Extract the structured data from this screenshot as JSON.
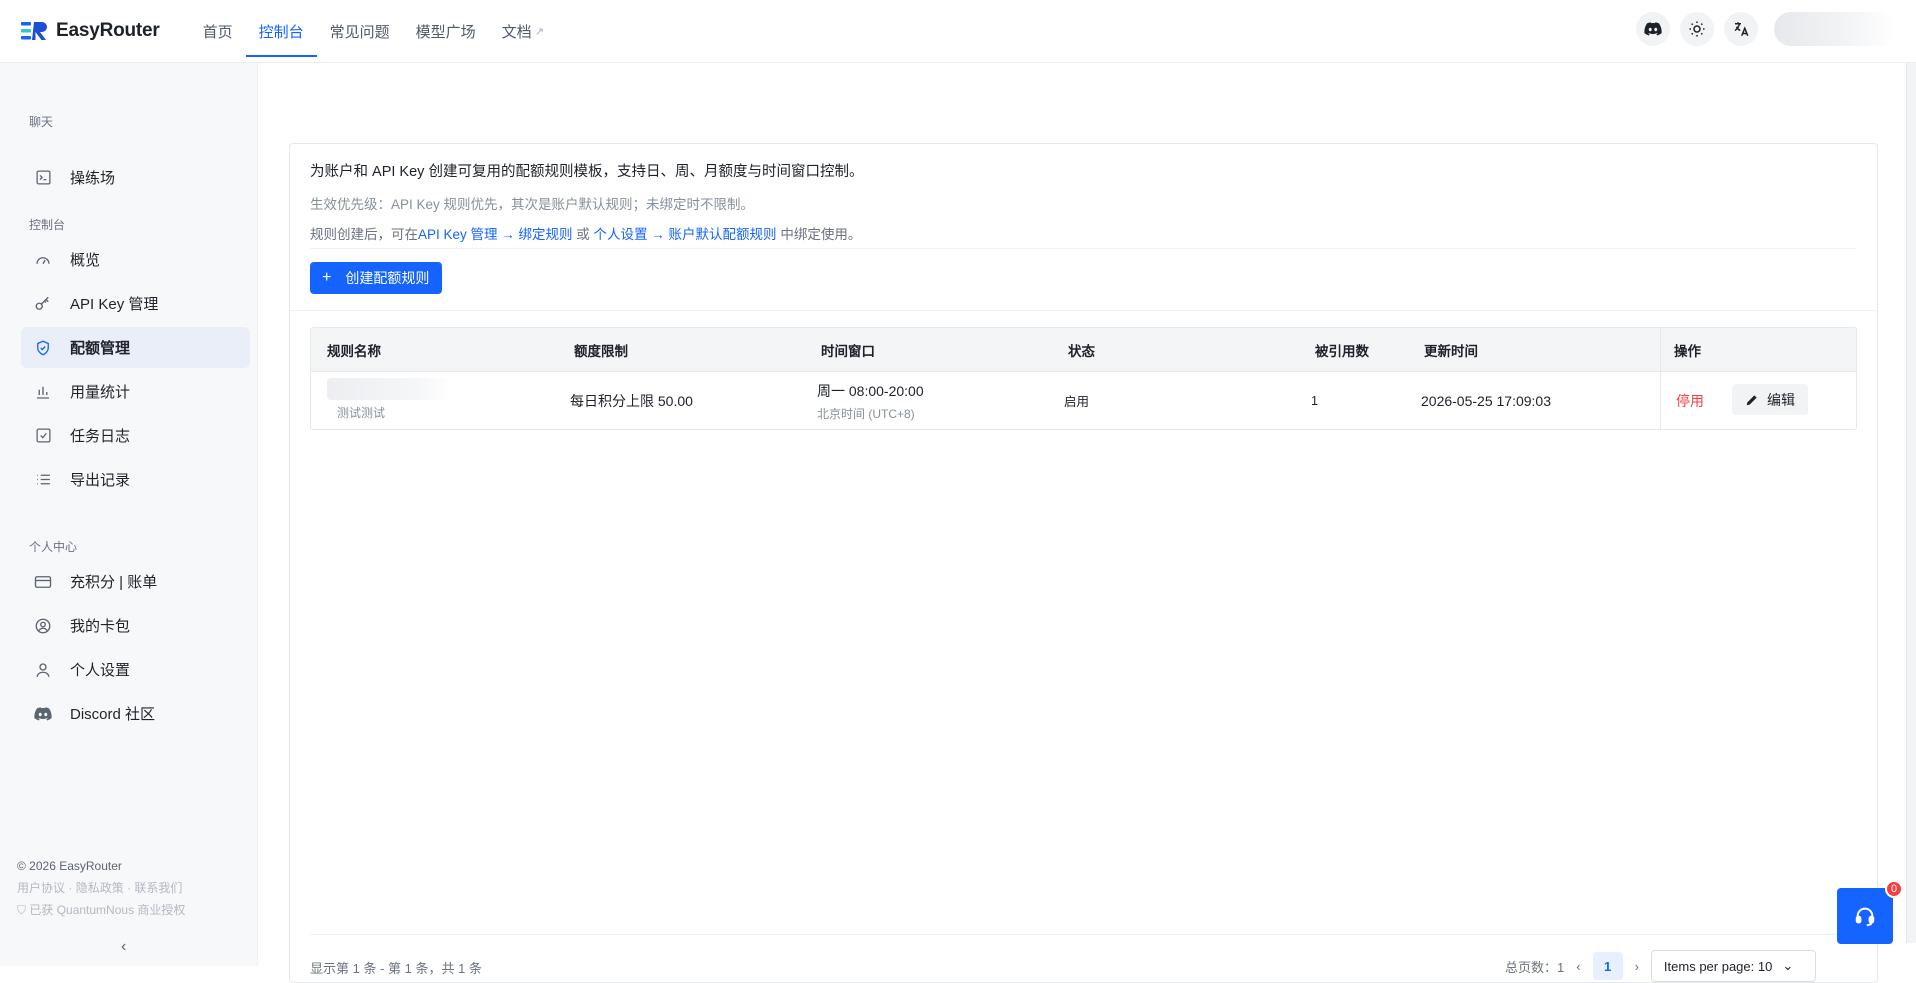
{
  "app": {
    "name": "EasyRouter"
  },
  "nav": {
    "items": [
      "首页",
      "控制台",
      "常见问题",
      "模型广场",
      "文档"
    ],
    "active": "控制台"
  },
  "header_icons": [
    "discord-icon",
    "sun-icon",
    "translate-icon"
  ],
  "sidebar": {
    "groups": [
      {
        "title": "聊天",
        "items": [
          {
            "label": "操练场",
            "icon": "terminal-icon"
          }
        ]
      },
      {
        "title": "控制台",
        "items": [
          {
            "label": "概览",
            "icon": "gauge-icon"
          },
          {
            "label": "API Key 管理",
            "icon": "key-icon"
          },
          {
            "label": "配额管理",
            "icon": "shield-check-icon",
            "active": true
          },
          {
            "label": "用量统计",
            "icon": "bar-chart-icon"
          },
          {
            "label": "任务日志",
            "icon": "checkbox-icon"
          },
          {
            "label": "导出记录",
            "icon": "list-icon"
          }
        ]
      },
      {
        "title": "个人中心",
        "items": [
          {
            "label": "充积分 | 账单",
            "icon": "credit-card-icon"
          },
          {
            "label": "我的卡包",
            "icon": "user-circle-icon"
          },
          {
            "label": "个人设置",
            "icon": "user-icon"
          },
          {
            "label": "Discord 社区",
            "icon": "discord-icon"
          }
        ]
      }
    ],
    "footer": {
      "copyright": "© 2026 EasyRouter",
      "links": [
        "用户协议",
        "隐私政策",
        "联系我们"
      ],
      "license": "已获 QuantumNous 商业授权"
    }
  },
  "intro": {
    "line1": "为账户和 API Key 创建可复用的配额规则模板，支持日、周、月额度与时间窗口控制。",
    "line2": "生效优先级：API Key 规则优先，其次是账户默认规则；未绑定时不限制。",
    "line3_prefix": "规则创建后，可在",
    "line3_link1": "API Key 管理 → 绑定规则",
    "line3_mid": " 或 ",
    "line3_link2": "个人设置 → 账户默认配额规则",
    "line3_suffix": " 中绑定使用。"
  },
  "create_button": "创建配额规则",
  "table": {
    "headers": [
      "规则名称",
      "额度限制",
      "时间窗口",
      "状态",
      "被引用数",
      "更新时间",
      "操作"
    ],
    "rows": [
      {
        "name_sub": "测试测试",
        "limit": "每日积分上限 50.00",
        "window": "周一 08:00-20:00",
        "window_tz": "北京时间 (UTC+8)",
        "status": "启用",
        "refs": "1",
        "updated": "2026-05-25 17:09:03",
        "action_disable": "停用",
        "action_edit": "编辑"
      }
    ]
  },
  "pagination": {
    "summary": "显示第 1 条 - 第 1 条，共 1 条",
    "total_pages": "总页数：1",
    "current_page": "1",
    "per_page": "Items per page: 10"
  },
  "support": {
    "badge": "0"
  }
}
